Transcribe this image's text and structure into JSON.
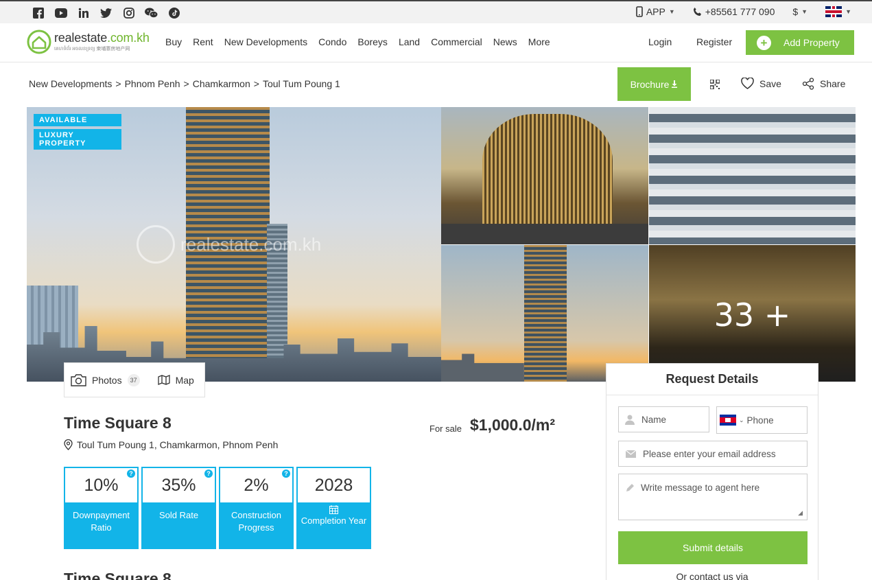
{
  "topbar": {
    "social_icons": [
      "facebook-icon",
      "youtube-icon",
      "linkedin-icon",
      "twitter-icon",
      "instagram-icon",
      "wechat-icon",
      "tiktok-icon"
    ],
    "app_label": "APP",
    "phone": "+85561 777 090",
    "currency": "$",
    "language_flag": "uk-flag-icon"
  },
  "header": {
    "logo_main": "realestate",
    "logo_domain": ".com.kh",
    "logo_sub": "គេហទំព័រ អចលនទ្រព្យ 柬埔寨房地产网",
    "nav": [
      "Buy",
      "Rent",
      "New Developments",
      "Condo",
      "Boreys",
      "Land",
      "Commercial",
      "News",
      "More"
    ],
    "login": "Login",
    "register": "Register",
    "add_property": "Add Property"
  },
  "breadcrumb": [
    "New Developments",
    "Phnom Penh",
    "Chamkarmon",
    "Toul Tum Poung 1"
  ],
  "breadcrumb_sep": ">",
  "actions": {
    "brochure": "Brochure",
    "save": "Save",
    "share": "Share"
  },
  "gallery": {
    "badges": [
      "AVAILABLE",
      "LUXURY PROPERTY"
    ],
    "watermark": "realestate.com.kh",
    "more_count": "33 +",
    "photos_label": "Photos",
    "photos_count": "37",
    "map_label": "Map"
  },
  "listing": {
    "title": "Time Square 8",
    "address": "Toul Tum Poung 1, Chamkarmon, Phnom Penh",
    "for_sale_label": "For sale",
    "price": "$1,000.0/m²",
    "stats": [
      {
        "value": "10%",
        "label": "Downpayment Ratio",
        "has_help": true
      },
      {
        "value": "35%",
        "label": "Sold Rate",
        "has_help": true
      },
      {
        "value": "2%",
        "label": "Construction Progress",
        "has_help": true
      },
      {
        "value": "2028",
        "label": "Completion Year",
        "has_help": false
      }
    ],
    "section_title": "Time Square 8"
  },
  "request_form": {
    "heading": "Request Details",
    "name_placeholder": "Name",
    "phone_placeholder": "Phone",
    "email_placeholder": "Please enter your email address",
    "message_placeholder": "Write message to agent here",
    "submit": "Submit details",
    "contact_via": "Or contact us via"
  },
  "colors": {
    "brand_green": "#7dc242",
    "accent_blue": "#12b4e8"
  }
}
